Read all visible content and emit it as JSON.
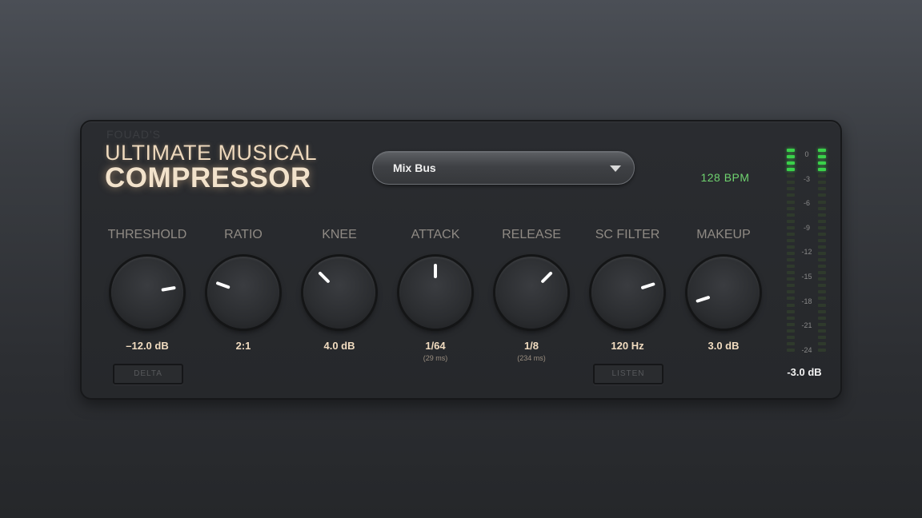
{
  "brand": {
    "vendor": "FOUAD'S",
    "line1": "ULTIMATE MUSICAL",
    "line2": "COMPRESSOR"
  },
  "preset": {
    "selected": "Mix Bus",
    "caret_icon": "caret-down-icon"
  },
  "tempo": {
    "label": "128 BPM",
    "color": "#6fd36f"
  },
  "knobs": [
    {
      "label": "THRESHOLD",
      "value": "–12.0 dB",
      "sub": "",
      "angle_deg": 80
    },
    {
      "label": "RATIO",
      "value": "2:1",
      "sub": "",
      "angle_deg": -70
    },
    {
      "label": "KNEE",
      "value": "4.0 dB",
      "sub": "",
      "angle_deg": -45
    },
    {
      "label": "ATTACK",
      "value": "1/64",
      "sub": "(29 ms)",
      "angle_deg": 0
    },
    {
      "label": "RELEASE",
      "value": "1/8",
      "sub": "(234 ms)",
      "angle_deg": 45
    },
    {
      "label": "SC FILTER",
      "value": "120 Hz",
      "sub": "",
      "angle_deg": 72
    },
    {
      "label": "MAKEUP",
      "value": "3.0 dB",
      "sub": "",
      "angle_deg": -108
    }
  ],
  "buttons": {
    "delta": "DELTA",
    "listen": "LISTEN"
  },
  "meter": {
    "ticks": [
      "0",
      "-3",
      "-6",
      "-9",
      "-12",
      "-15",
      "-18",
      "-21",
      "-24"
    ],
    "segments_per_column": 32,
    "lit_segments": 4,
    "readout": "-3.0 dB",
    "lit_color": "#3ad14a"
  },
  "colors": {
    "accent": "#f1dcc0",
    "panel": "#26282b"
  }
}
